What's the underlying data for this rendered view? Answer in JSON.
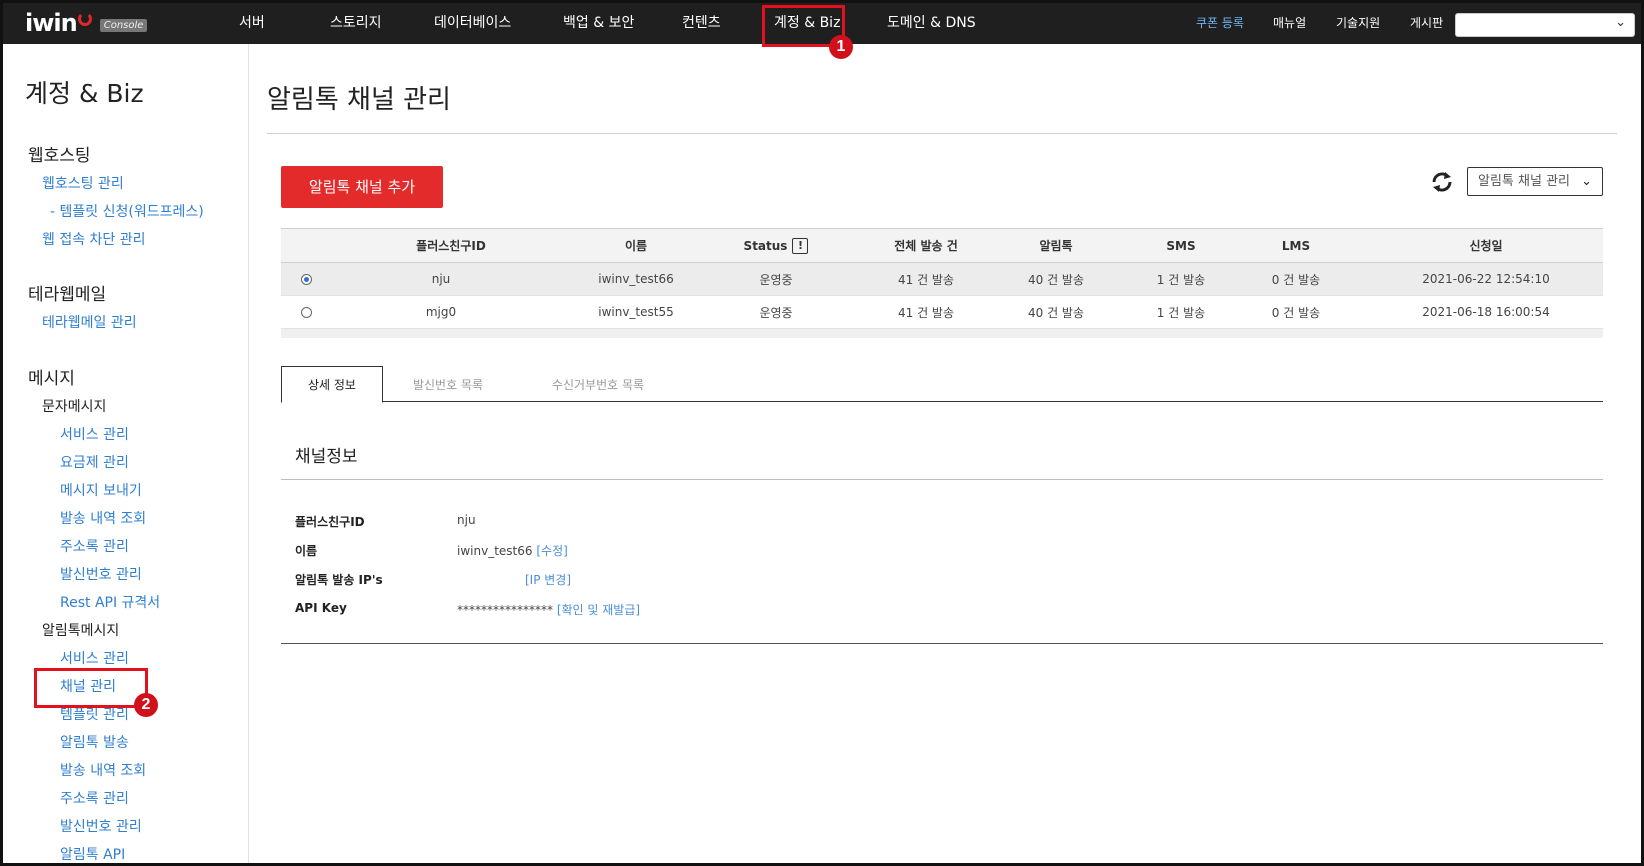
{
  "topnav": {
    "logo": "iwin",
    "logo_badge": "Console",
    "items": [
      "서버",
      "스토리지",
      "데이터베이스",
      "백업 & 보안",
      "컨텐츠",
      "계정 & Biz",
      "도메인 & DNS"
    ],
    "right_links": [
      "쿠폰 등록",
      "매뉴얼",
      "기술지원",
      "게시판"
    ],
    "select_value": ""
  },
  "annotations": {
    "step1": "1",
    "step2": "2"
  },
  "sidebar": {
    "title": "계정 & Biz",
    "sections": [
      {
        "label": "웹호스팅",
        "links": [
          "웹호스팅 관리",
          "- 템플릿 신청(워드프레스)",
          "웹 접속 차단 관리"
        ]
      },
      {
        "label": "테라웹메일",
        "links": [
          "테라웹메일 관리"
        ]
      },
      {
        "label": "메시지"
      }
    ],
    "sms": {
      "label": "문자메시지",
      "links": [
        "서비스 관리",
        "요금제 관리",
        "메시지 보내기",
        "발송 내역 조회",
        "주소록 관리",
        "발신번호 관리",
        "Rest API 규격서"
      ]
    },
    "alimtalk": {
      "label": "알림톡메시지",
      "links": [
        "서비스 관리",
        "채널 관리",
        "템플릿 관리",
        "알림톡 발송",
        "발송 내역 조회",
        "주소록 관리",
        "발신번호 관리",
        "알림톡 API"
      ]
    }
  },
  "main": {
    "title": "알림톡 채널 관리",
    "add_button": "알림톡 채널 추가",
    "dropdown_value": "알림톡 채널 관리",
    "table": {
      "headers": [
        "플러스친구ID",
        "이름",
        "Status",
        "전체 발송 건",
        "알림톡",
        "SMS",
        "LMS",
        "신청일"
      ],
      "status_icon": "!",
      "rows": [
        {
          "selected": true,
          "cells": [
            "nju",
            "iwinv_test66",
            "운영중",
            "41 건 발송",
            "40 건 발송",
            "1 건 발송",
            "0 건 발송",
            "2021-06-22 12:54:10"
          ]
        },
        {
          "selected": false,
          "cells": [
            "mjg0",
            "iwinv_test55",
            "운영중",
            "41 건 발송",
            "40 건 발송",
            "1 건 발송",
            "0 건 발송",
            "2021-06-18 16:00:54"
          ]
        }
      ]
    },
    "tabs": [
      "상세 정보",
      "발신번호 목록",
      "수신거부번호 목록"
    ],
    "section_title": "채널정보",
    "info": {
      "labels": [
        "플러스친구ID",
        "이름",
        "알림톡 발송 IP's",
        "API Key"
      ],
      "plusfriend_id": "nju",
      "name": "iwinv_test66",
      "name_link": "[수정]",
      "ip_link": "[IP 변경]",
      "api_key": "****************",
      "api_link": "[확인 및 재발급]"
    }
  }
}
